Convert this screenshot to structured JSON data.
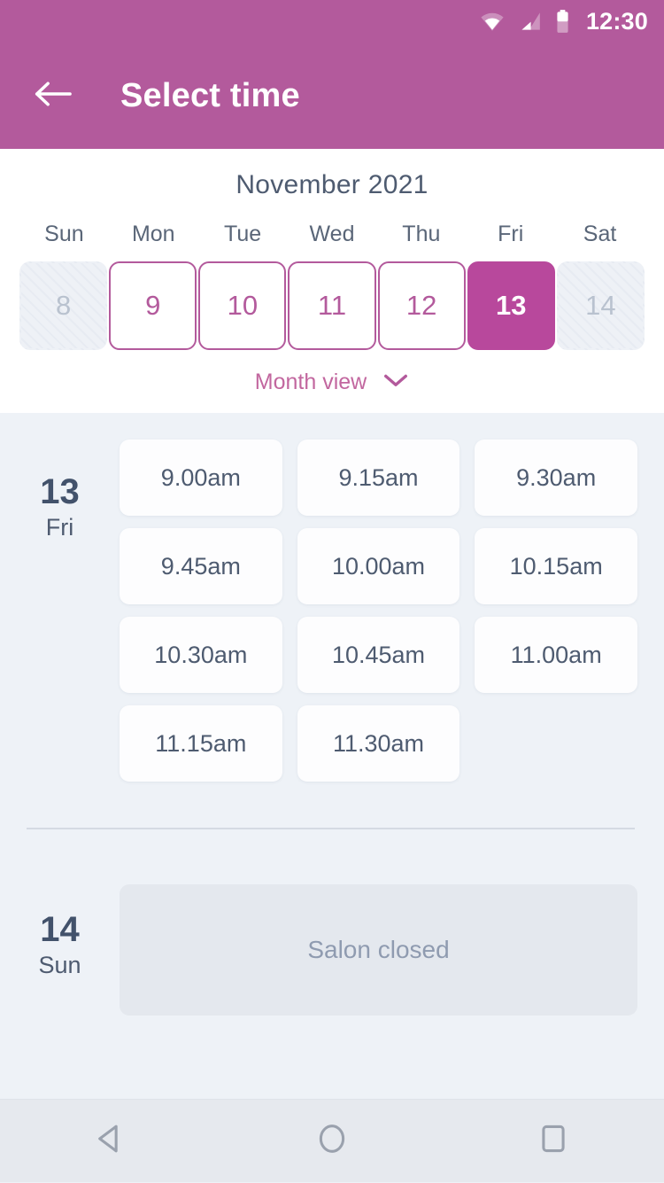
{
  "status_bar": {
    "time": "12:30",
    "icons": [
      "wifi-icon",
      "signal-icon",
      "battery-icon"
    ]
  },
  "app_bar": {
    "back_icon": "arrow-left-icon",
    "title": "Select time"
  },
  "calendar": {
    "month_title": "November 2021",
    "weekdays": [
      "Sun",
      "Mon",
      "Tue",
      "Wed",
      "Thu",
      "Fri",
      "Sat"
    ],
    "days": [
      {
        "number": "8",
        "state": "disabled"
      },
      {
        "number": "9",
        "state": "available"
      },
      {
        "number": "10",
        "state": "available"
      },
      {
        "number": "11",
        "state": "available"
      },
      {
        "number": "12",
        "state": "available"
      },
      {
        "number": "13",
        "state": "selected"
      },
      {
        "number": "14",
        "state": "disabled"
      }
    ],
    "month_view_label": "Month view",
    "month_view_icon": "chevron-down-icon"
  },
  "slots_area": {
    "groups": [
      {
        "day_number": "13",
        "day_name": "Fri",
        "closed": false,
        "slots": [
          "9.00am",
          "9.15am",
          "9.30am",
          "9.45am",
          "10.00am",
          "10.15am",
          "10.30am",
          "10.45am",
          "11.00am",
          "11.15am",
          "11.30am"
        ]
      },
      {
        "day_number": "14",
        "day_name": "Sun",
        "closed": true,
        "closed_label": "Salon closed",
        "slots": []
      }
    ]
  },
  "nav_bar": {
    "back": "android-back-icon",
    "home": "android-home-icon",
    "recents": "android-recents-icon"
  },
  "colors": {
    "brand": "#b35a9c",
    "brand_selected": "#b8489c",
    "text_dark": "#4e5b70",
    "background": "#eef2f7",
    "card": "#fdfdfe",
    "closed_card": "#e4e8ee"
  }
}
